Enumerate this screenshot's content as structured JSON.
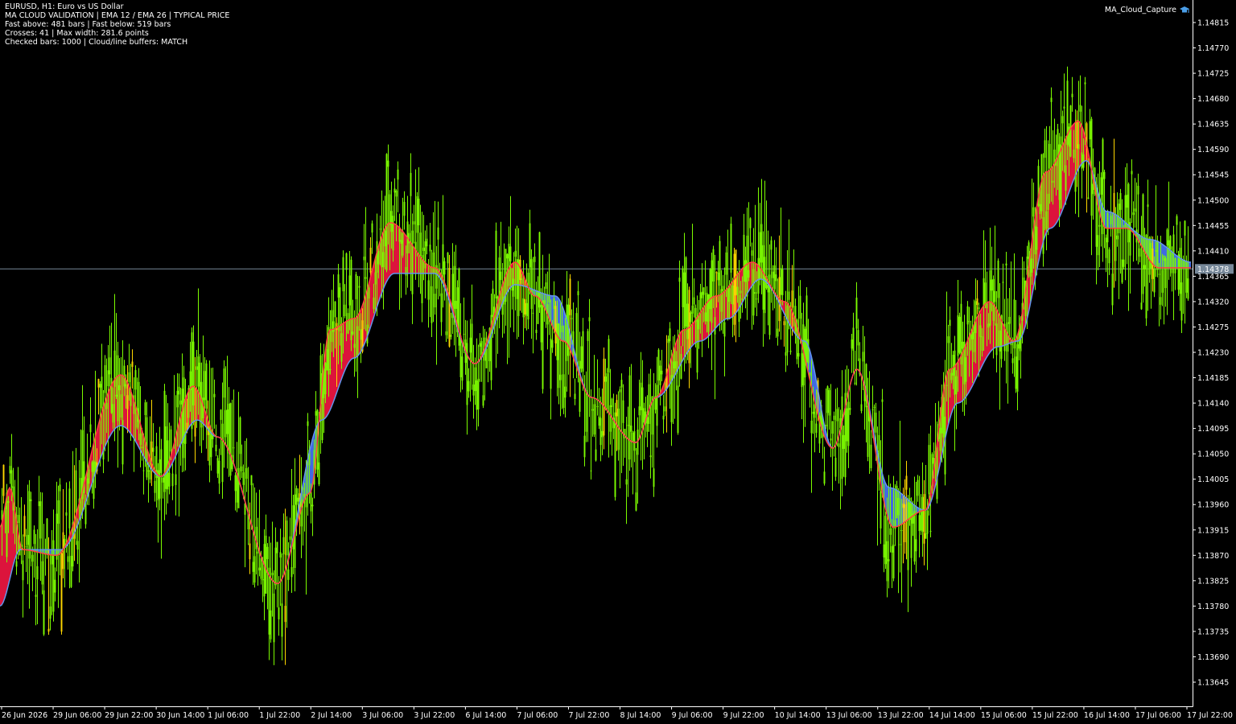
{
  "window": {
    "symbol_line": "EURUSD, H1:  Euro vs US Dollar",
    "info_lines": [
      "MA CLOUD VALIDATION | EMA 12 / EMA 26 | TYPICAL PRICE",
      "Fast above: 481 bars | Fast below: 519 bars",
      "Crosses: 41 | Max width: 281.6 points",
      "Checked bars: 1000 | Cloud/line buffers: MATCH"
    ],
    "expert_name": "MA_Cloud_Capture",
    "expert_icon": "graduation-cap-icon"
  },
  "colors": {
    "background": "#000000",
    "candles": "#7CFC00",
    "cloud_fast_above": "#DC143C",
    "cloud_fast_below": "#4169E1",
    "fast_line": "#FF4040",
    "slow_line": "#6495ED",
    "highlight": "#FFD700",
    "axis": "#FFFFFF",
    "price_line": "#778899"
  },
  "chart_data": {
    "type": "line",
    "title": "",
    "xlabel": "",
    "ylabel": "",
    "current_price": 1.14378,
    "ylim": [
      1.1362,
      1.1482
    ],
    "y_ticks": [
      1.14815,
      1.1477,
      1.14725,
      1.1468,
      1.14635,
      1.1459,
      1.14545,
      1.145,
      1.14455,
      1.1441,
      1.14365,
      1.1432,
      1.14275,
      1.1423,
      1.14185,
      1.1414,
      1.14095,
      1.1405,
      1.14005,
      1.1396,
      1.13915,
      1.1387,
      1.13825,
      1.1378,
      1.13735,
      1.1369,
      1.13645
    ],
    "x_ticks": [
      "26 Jun 2026",
      "29 Jun 06:00",
      "29 Jun 22:00",
      "30 Jun 14:00",
      "1 Jul 06:00",
      "1 Jul 22:00",
      "2 Jul 14:00",
      "3 Jul 06:00",
      "3 Jul 22:00",
      "6 Jul 14:00",
      "7 Jul 06:00",
      "7 Jul 22:00",
      "8 Jul 14:00",
      "9 Jul 06:00",
      "9 Jul 22:00",
      "10 Jul 14:00",
      "13 Jul 06:00",
      "13 Jul 22:00",
      "14 Jul 14:00",
      "15 Jul 06:00",
      "15 Jul 22:00",
      "16 Jul 14:00",
      "17 Jul 06:00",
      "17 Jul 22:00"
    ],
    "series": [
      {
        "kind": "fast_ema",
        "keys": [
          0,
          1.1392,
          12,
          1.1399,
          28,
          1.1388,
          70,
          1.1387,
          150,
          1.1419,
          200,
          1.1401,
          240,
          1.1417,
          270,
          1.1408,
          345,
          1.1382,
          385,
          1.1398,
          410,
          1.1427,
          440,
          1.1429,
          485,
          1.1446,
          540,
          1.1438,
          590,
          1.1421,
          640,
          1.1439,
          665,
          1.1433,
          700,
          1.1425,
          735,
          1.1415,
          790,
          1.1407,
          815,
          1.1415,
          850,
          1.1427,
          890,
          1.1433,
          935,
          1.1439,
          975,
          1.1432,
          1035,
          1.1406,
          1065,
          1.142,
          1110,
          1.1392,
          1150,
          1.1395,
          1180,
          1.142,
          1230,
          1.1432,
          1260,
          1.1425,
          1300,
          1.1455,
          1340,
          1.1464,
          1375,
          1.1445,
          1400,
          1.1445,
          1440,
          1.1438,
          1480,
          1.1438
        ]
      },
      {
        "kind": "slow_ema",
        "keys": [
          0,
          1.1378,
          25,
          1.1388,
          75,
          1.1388,
          150,
          1.141,
          200,
          1.1401,
          245,
          1.1411,
          270,
          1.1408,
          345,
          1.1382,
          400,
          1.1411,
          440,
          1.1422,
          490,
          1.1437,
          540,
          1.1437,
          590,
          1.1421,
          640,
          1.1435,
          690,
          1.1433,
          735,
          1.1415,
          790,
          1.1407,
          815,
          1.1415,
          870,
          1.1425,
          905,
          1.1429,
          945,
          1.1436,
          1000,
          1.1425,
          1035,
          1.1406,
          1065,
          1.142,
          1105,
          1.1399,
          1150,
          1.1395,
          1190,
          1.1414,
          1240,
          1.1424,
          1265,
          1.1425,
          1305,
          1.1445,
          1350,
          1.1457,
          1375,
          1.1448,
          1430,
          1.1443,
          1480,
          1.1439
        ]
      }
    ]
  }
}
